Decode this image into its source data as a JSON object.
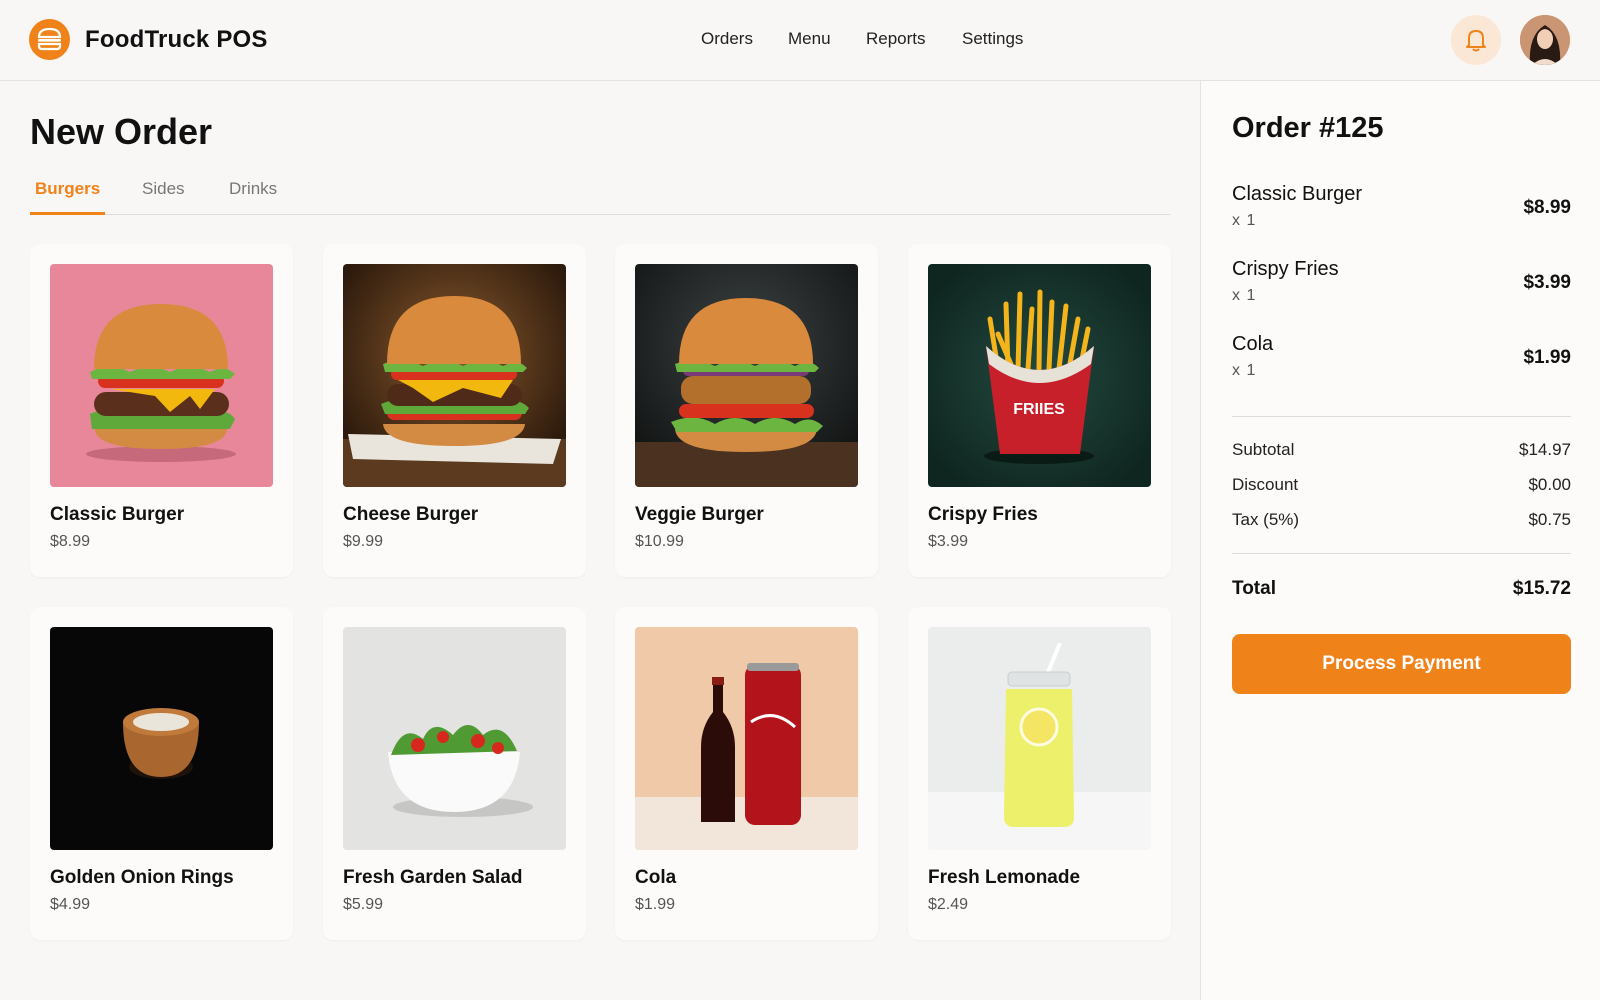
{
  "app": {
    "title": "FoodTruck POS",
    "brand_color": "#f0821a"
  },
  "nav": {
    "items": [
      {
        "label": "Orders"
      },
      {
        "label": "Menu"
      },
      {
        "label": "Reports"
      },
      {
        "label": "Settings"
      }
    ],
    "icons": [
      "bell-icon",
      "avatar"
    ]
  },
  "main": {
    "title": "New Order",
    "tabs": [
      {
        "label": "Burgers",
        "active": true
      },
      {
        "label": "Sides",
        "active": false
      },
      {
        "label": "Drinks",
        "active": false
      }
    ],
    "products": [
      {
        "name": "Classic Burger",
        "price": "$8.99",
        "image": "burger-pink-background"
      },
      {
        "name": "Cheese Burger",
        "price": "$9.99",
        "image": "cheese-burger-brown-background"
      },
      {
        "name": "Veggie Burger",
        "price": "$10.99",
        "image": "veggie-burger-dark-background"
      },
      {
        "name": "Crispy Fries",
        "price": "$3.99",
        "image": "fries-red-box",
        "image_text": "FRIIES"
      },
      {
        "name": "Golden Onion Rings",
        "price": "$4.99",
        "image": "onion-ring-black-background"
      },
      {
        "name": "Fresh Garden Salad",
        "price": "$5.99",
        "image": "salad-bowl-white-background"
      },
      {
        "name": "Cola",
        "price": "$1.99",
        "image": "cola-bottle-and-can"
      },
      {
        "name": "Fresh Lemonade",
        "price": "$2.49",
        "image": "lemonade-jar"
      }
    ]
  },
  "order": {
    "title": "Order #125",
    "items": [
      {
        "name": "Classic Burger",
        "qty": "x 1",
        "price": "$8.99"
      },
      {
        "name": "Crispy Fries",
        "qty": "x 1",
        "price": "$3.99"
      },
      {
        "name": "Cola",
        "qty": "x 1",
        "price": "$1.99"
      }
    ],
    "summary": [
      {
        "label": "Subtotal",
        "value": "$14.97"
      },
      {
        "label": "Discount",
        "value": "$0.00"
      },
      {
        "label": "Tax (5%)",
        "value": "$0.75"
      }
    ],
    "total_label": "Total",
    "total_value": "$15.72",
    "pay_label": "Process Payment"
  }
}
